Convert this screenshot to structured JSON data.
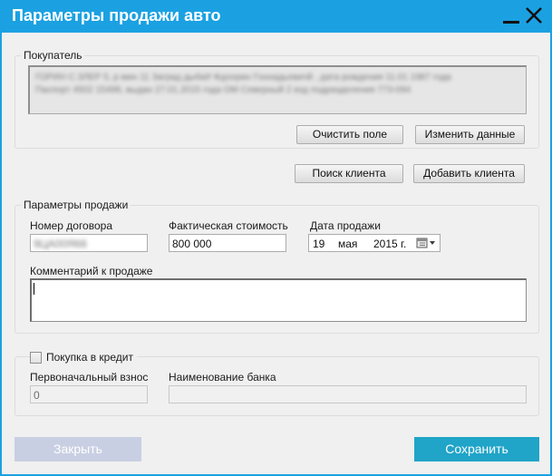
{
  "window": {
    "title": "Параметры продажи авто"
  },
  "buyer": {
    "group_label": "Покупатель",
    "line1": "ГОРИН С.ЗЛЕР 5, р мин 11 Заград дыбкИ Фдоорин Гоннадьевичй , дата рождения 11.01 1987 года",
    "line2": "Паспорт 4502 15498, выдан 27.01.2015 года ОМ Северный 2 код подразделения 773-094",
    "clear_label": "Очистить поле",
    "edit_label": "Изменить данные"
  },
  "client_actions": {
    "search_label": "Поиск клиента",
    "add_label": "Добавить клиента"
  },
  "sale": {
    "group_label": "Параметры продажи",
    "contract_label": "Номер договора",
    "contract_value": "9ЦА00Я66",
    "price_label": "Фактическая стоимость",
    "price_value": "800 000",
    "date_label": "Дата продажи",
    "date_day": "19",
    "date_month": "мая",
    "date_year": "2015 г.",
    "comment_label": "Комментарий к продаже",
    "comment_value": ""
  },
  "credit": {
    "checkbox_label": "Покупка в кредит",
    "checked": false,
    "down_payment_label": "Первоначальный взнос",
    "down_payment_value": "0",
    "bank_label": "Наименование банка",
    "bank_value": ""
  },
  "footer": {
    "close_label": "Закрыть",
    "save_label": "Сохранить"
  },
  "colors": {
    "accent": "#1ba1e2",
    "disabled_button": "#c9cfe3",
    "save_button": "#20a4c8"
  }
}
